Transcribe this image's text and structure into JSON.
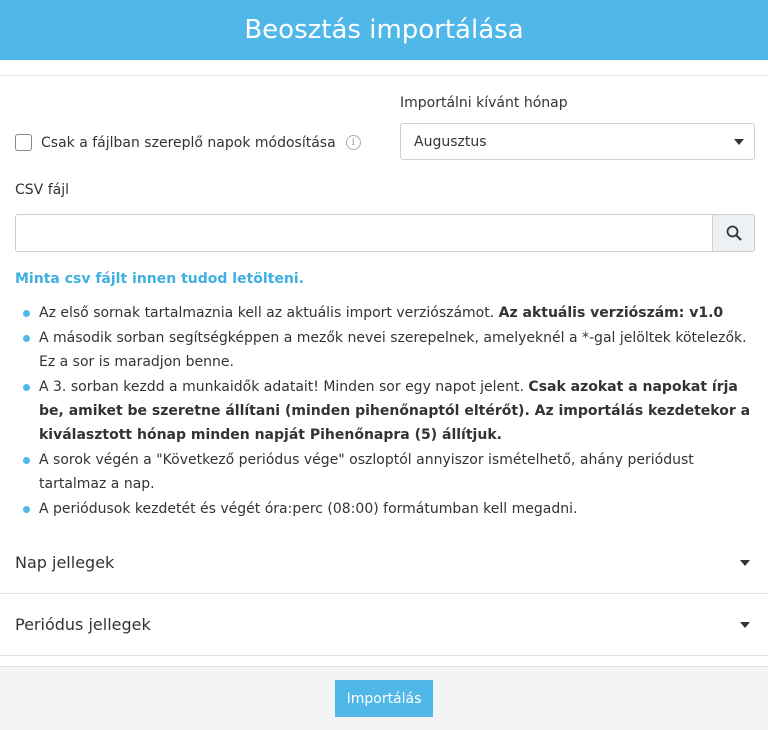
{
  "header": {
    "title": "Beosztás importálása"
  },
  "form": {
    "only_file_days_label": "Csak a fájlban szereplő napok módosítása",
    "info_glyph": "i",
    "month_label": "Importálni kívánt hónap",
    "month_selected": "Augusztus",
    "csv_label": "CSV fájl",
    "csv_value": ""
  },
  "sample_link": "Minta csv fájlt innen tudod letölteni.",
  "rules": [
    {
      "text": "Az első sornak tartalmaznia kell az aktuális import verziószámot. ",
      "bold": "Az aktuális verziószám: v1.0"
    },
    {
      "text": "A második sorban segítségképpen a mezők nevei szerepelnek, amelyeknél a *-gal jelöltek kötelezők. Ez a sor is maradjon benne.",
      "bold": ""
    },
    {
      "text": "A 3. sorban kezdd a munkaidők adatait! Minden sor egy napot jelent. ",
      "bold": "Csak azokat a napokat írja be, amiket be szeretne állítani (minden pihenőnaptól eltérőt). Az importálás kezdetekor a kiválasztott hónap minden napját Pihenőnapra (5) állítjuk."
    },
    {
      "text": "A sorok végén a \"Következő periódus vége\" oszloptól annyiszor ismételhető, ahány periódust tartalmaz a nap.",
      "bold": ""
    },
    {
      "text": "A periódusok kezdetét és végét óra:perc (08:00) formátumban kell megadni.",
      "bold": ""
    }
  ],
  "accordions": [
    {
      "label": "Nap jellegek"
    },
    {
      "label": "Periódus jellegek"
    }
  ],
  "footer": {
    "import_label": "Importálás"
  },
  "colors": {
    "accent": "#4fb8e8",
    "link": "#3fb0e4"
  }
}
